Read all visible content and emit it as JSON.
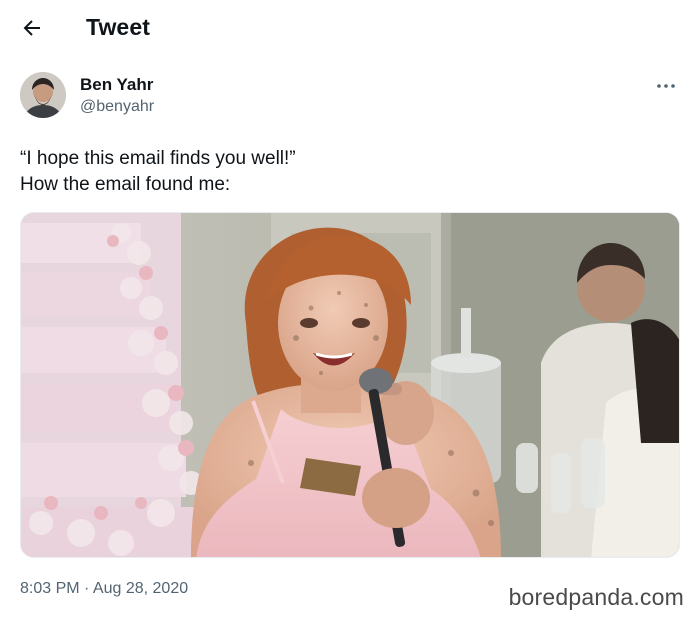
{
  "header": {
    "title": "Tweet",
    "back_icon": "arrow-left-icon"
  },
  "author": {
    "display_name": "Ben Yahr",
    "handle": "@benyahr",
    "avatar": "user-avatar",
    "more_icon": "more-horizontal-icon"
  },
  "tweet": {
    "line1": "“I hope this email finds you well!”",
    "line2": "How the email found me:"
  },
  "media": {
    "type": "photo"
  },
  "meta": {
    "timestamp": "8:03 PM · Aug 28, 2020"
  },
  "watermark": "boredpanda.com",
  "colors": {
    "text": "#0f1419",
    "secondary": "#536471",
    "background": "#ffffff"
  }
}
